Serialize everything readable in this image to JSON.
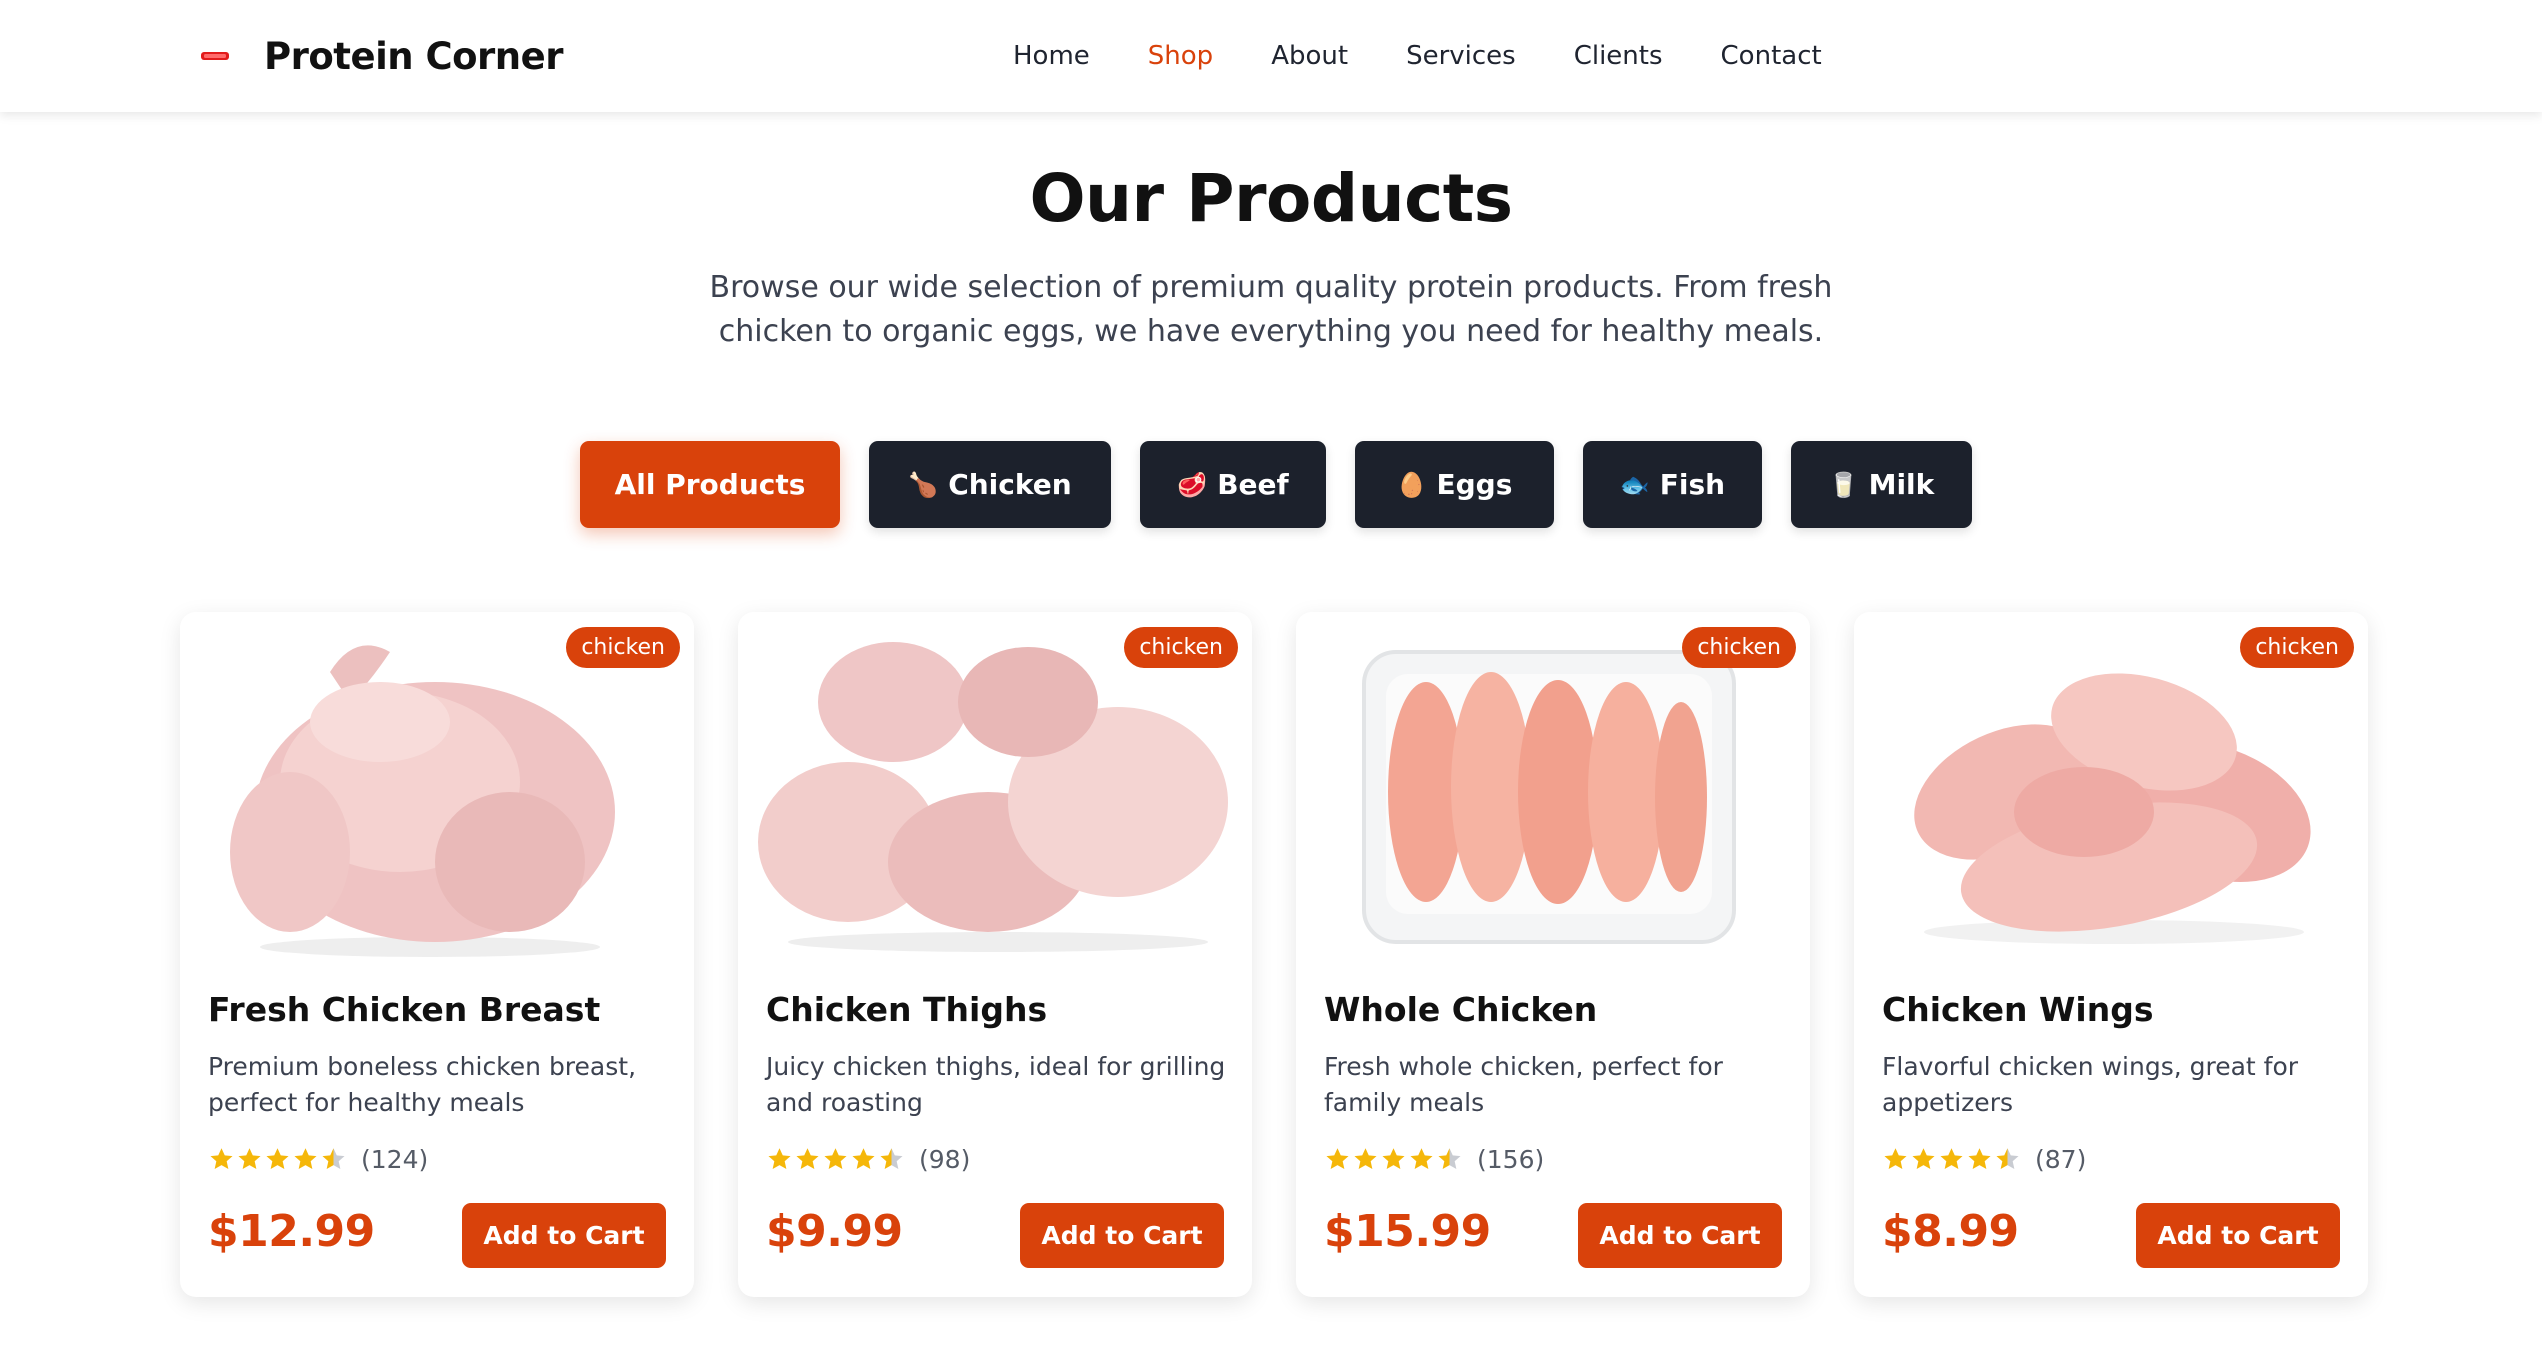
{
  "colors": {
    "accent": "#d9420b",
    "dark": "#1c212c",
    "star": "#f5b70a"
  },
  "header": {
    "logo_icon": "protein-logo-icon",
    "brand": "Protein Corner",
    "nav": [
      {
        "label": "Home",
        "active": false
      },
      {
        "label": "Shop",
        "active": true
      },
      {
        "label": "About",
        "active": false
      },
      {
        "label": "Services",
        "active": false
      },
      {
        "label": "Clients",
        "active": false
      },
      {
        "label": "Contact",
        "active": false
      }
    ]
  },
  "hero": {
    "title": "Our Products",
    "subtitle": "Browse our wide selection of premium quality protein products. From fresh chicken to organic eggs, we have everything you need for healthy meals."
  },
  "filters": [
    {
      "label": "All Products",
      "icon": "",
      "active": true
    },
    {
      "label": "Chicken",
      "icon": "🍗",
      "active": false
    },
    {
      "label": "Beef",
      "icon": "🥩",
      "active": false
    },
    {
      "label": "Eggs",
      "icon": "🥚",
      "active": false
    },
    {
      "label": "Fish",
      "icon": "🐟",
      "active": false
    },
    {
      "label": "Milk",
      "icon": "🥛",
      "active": false
    }
  ],
  "products": [
    {
      "name": "Fresh Chicken Breast",
      "description": "Premium boneless chicken breast, perfect for healthy meals",
      "category": "chicken",
      "rating": 4.5,
      "reviews": "(124)",
      "price": "$12.99",
      "cart_label": "Add to Cart",
      "image": "whole-raw-chicken-image"
    },
    {
      "name": "Chicken Thighs",
      "description": "Juicy chicken thighs, ideal for grilling and roasting",
      "category": "chicken",
      "rating": 4.5,
      "reviews": "(98)",
      "price": "$9.99",
      "cart_label": "Add to Cart",
      "image": "raw-chicken-thighs-image"
    },
    {
      "name": "Whole Chicken",
      "description": "Fresh whole chicken, perfect for family meals",
      "category": "chicken",
      "rating": 4.5,
      "reviews": "(156)",
      "price": "$15.99",
      "cart_label": "Add to Cart",
      "image": "packaged-chicken-breasts-image"
    },
    {
      "name": "Chicken Wings",
      "description": "Flavorful chicken wings, great for appetizers",
      "category": "chicken",
      "rating": 4.5,
      "reviews": "(87)",
      "price": "$8.99",
      "cart_label": "Add to Cart",
      "image": "raw-chicken-fillets-image"
    }
  ]
}
